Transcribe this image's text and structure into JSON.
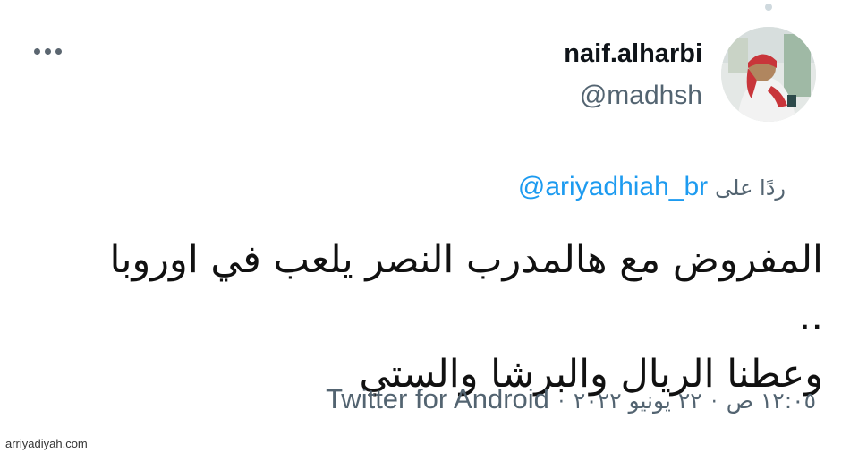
{
  "tweet": {
    "author_name": "naif.alharbi",
    "author_handle": "@madhsh",
    "reply_label": "ردًا على",
    "reply_to_handle": "@ariyadhiah_br",
    "text_line_1": "المفروض مع هالمدرب النصر يلعب في اوروبا ..",
    "text_line_2": "وعطنا الريال والبرشا والستي",
    "time": "١٢:٠٥ ص",
    "separator": "·",
    "date": "٢٢ يونيو ٢٠٢٢",
    "source": "Twitter for Android"
  },
  "watermark": "arriyadiyah.com",
  "colors": {
    "link_blue": "#1d9bf0",
    "secondary_gray": "#536471",
    "text_dark": "#0f1419"
  },
  "icons": {
    "more": "more-options-icon",
    "avatar": "avatar-image"
  }
}
